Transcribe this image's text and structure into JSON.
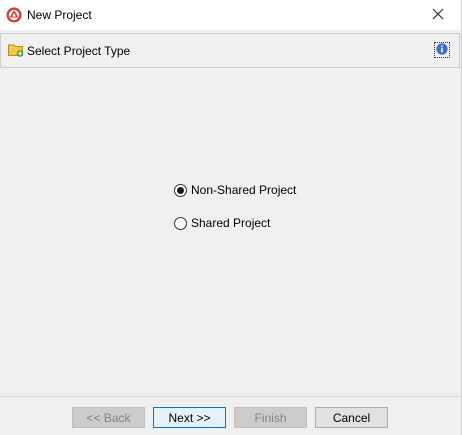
{
  "window": {
    "title": "New Project",
    "icons": {
      "app": "app-logo-icon",
      "close": "close-icon"
    }
  },
  "header": {
    "title": "Select Project Type",
    "icons": {
      "folder": "folder-add-icon",
      "info": "info-icon"
    }
  },
  "options": [
    {
      "label": "Non-Shared Project",
      "selected": true
    },
    {
      "label": "Shared Project",
      "selected": false
    }
  ],
  "buttons": {
    "back": {
      "label": "<< Back",
      "enabled": false
    },
    "next": {
      "label": "Next >>",
      "enabled": true,
      "default": true
    },
    "finish": {
      "label": "Finish",
      "enabled": false
    },
    "cancel": {
      "label": "Cancel",
      "enabled": true
    }
  },
  "colors": {
    "accent": "#0078d7",
    "app_icon_red": "#d63a2f",
    "info_blue": "#3a6fc9",
    "folder_yellow": "#f3c94b",
    "folder_plus_green": "#3aa84a"
  }
}
